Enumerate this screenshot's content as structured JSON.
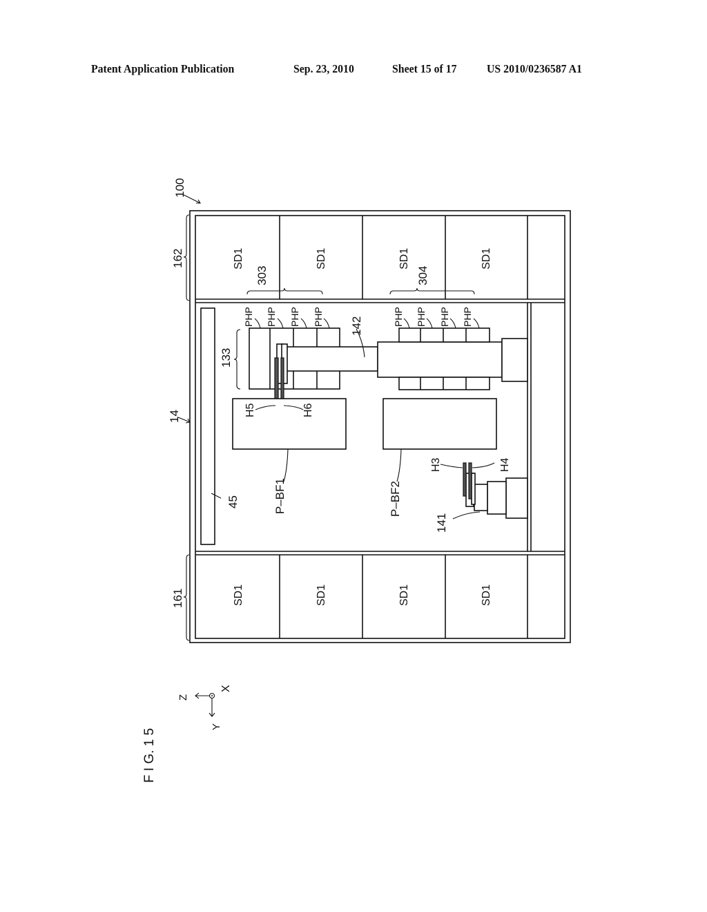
{
  "header": {
    "publication": "Patent Application Publication",
    "date": "Sep. 23, 2010",
    "sheet": "Sheet 15 of 17",
    "number": "US 2010/0236587 A1"
  },
  "figure": {
    "caption": "F I G. 1 5",
    "axes": {
      "z": "Z",
      "y": "Y",
      "x": "X"
    },
    "refs": {
      "apparatus": "100",
      "block": "14",
      "upper_unit": "162",
      "lower_unit": "161",
      "group_a": "303",
      "group_b": "304",
      "stack": "133",
      "robot_a": "142",
      "robot_b": "141",
      "rail": "45",
      "hand_h3": "H3",
      "hand_h4": "H4",
      "hand_h5": "H5",
      "hand_h6": "H6",
      "buffer_1": "P–BF1",
      "buffer_2": "P–BF2"
    },
    "upper_units": [
      "SD1",
      "SD1",
      "SD1",
      "SD1"
    ],
    "lower_units": [
      "SD1",
      "SD1",
      "SD1",
      "SD1"
    ],
    "php_left": [
      "PHP",
      "PHP",
      "PHP",
      "PHP"
    ],
    "php_right": [
      "PHP",
      "PHP",
      "PHP",
      "PHP"
    ]
  }
}
